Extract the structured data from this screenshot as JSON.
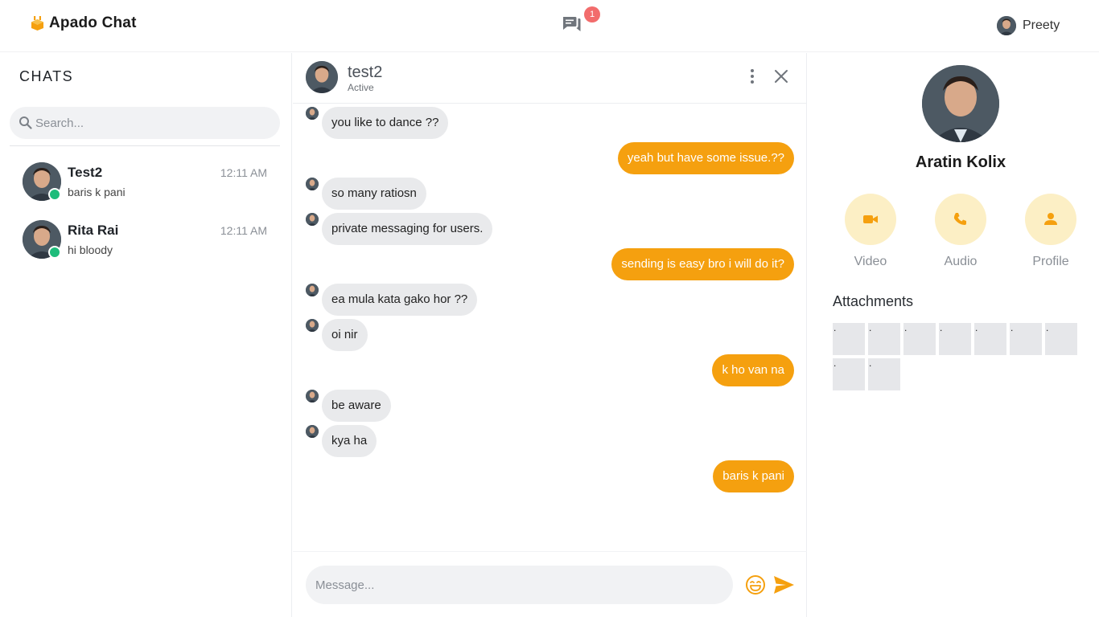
{
  "app": {
    "name": "Apado Chat",
    "brand_color": "#f5a00f",
    "notification_count": "1",
    "current_user": "Preety"
  },
  "sidebar": {
    "title": "CHATS",
    "search_placeholder": "Search...",
    "chats": [
      {
        "name": "Test2",
        "time": "12:11 AM",
        "preview": "baris k pani",
        "online": true
      },
      {
        "name": "Rita Rai",
        "time": "12:11 AM",
        "preview": "hi bloody",
        "online": true
      }
    ]
  },
  "conversation": {
    "name": "test2",
    "status": "Active",
    "messages": [
      {
        "from": "them",
        "text": "you like to dance ??"
      },
      {
        "from": "me",
        "text": "yeah but have some issue.??"
      },
      {
        "from": "them",
        "text": "so many ratiosn"
      },
      {
        "from": "them",
        "text": "private messaging for users."
      },
      {
        "from": "me",
        "text": "sending is easy bro i will do it?"
      },
      {
        "from": "them",
        "text": "ea mula kata gako hor ??"
      },
      {
        "from": "them",
        "text": "oi nir"
      },
      {
        "from": "me",
        "text": "k ho van na"
      },
      {
        "from": "them",
        "text": "be aware"
      },
      {
        "from": "them",
        "text": "kya ha"
      },
      {
        "from": "me",
        "text": "baris k pani"
      }
    ],
    "input_placeholder": "Message..."
  },
  "profile": {
    "name": "Aratin Kolix",
    "actions": [
      {
        "label": "Video",
        "icon": "video-icon"
      },
      {
        "label": "Audio",
        "icon": "phone-icon"
      },
      {
        "label": "Profile",
        "icon": "person-icon"
      }
    ],
    "attachments_title": "Attachments",
    "attachments": [
      ".",
      ".",
      ".",
      ".",
      ".",
      ".",
      ".",
      ".",
      "."
    ]
  },
  "colors": {
    "outgoing_bubble": "#f5a00f",
    "incoming_bubble": "#e9eaec",
    "online": "#1ebc7b",
    "badge": "#f26c6c",
    "action_circle": "#fcefc5"
  }
}
